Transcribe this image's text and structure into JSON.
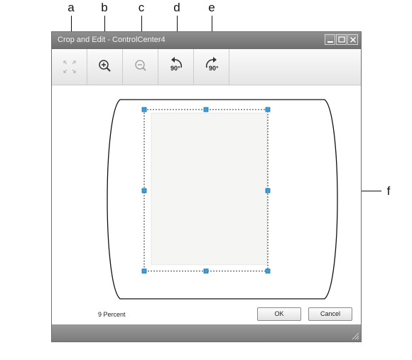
{
  "callouts": {
    "a": "a",
    "b": "b",
    "c": "c",
    "d": "d",
    "e": "e",
    "f": "f"
  },
  "window": {
    "title": "Crop and Edit - ControlCenter4"
  },
  "toolbar": {
    "buttons": [
      {
        "name": "fit-to-window",
        "icon": "fit-to-window-icon"
      },
      {
        "name": "zoom-in",
        "icon": "zoom-in-icon"
      },
      {
        "name": "zoom-out",
        "icon": "zoom-out-icon"
      },
      {
        "name": "rotate-left",
        "icon": "rotate-left-icon",
        "label": "90°"
      },
      {
        "name": "rotate-right",
        "icon": "rotate-right-icon",
        "label": "90°"
      }
    ]
  },
  "footer": {
    "zoom_text": "9 Percent",
    "ok_label": "OK",
    "cancel_label": "Cancel"
  },
  "colors": {
    "titlebar": "#7f7f7f",
    "crop_handle": "#3aa0d8",
    "statusbar": "#8a8a8a"
  }
}
